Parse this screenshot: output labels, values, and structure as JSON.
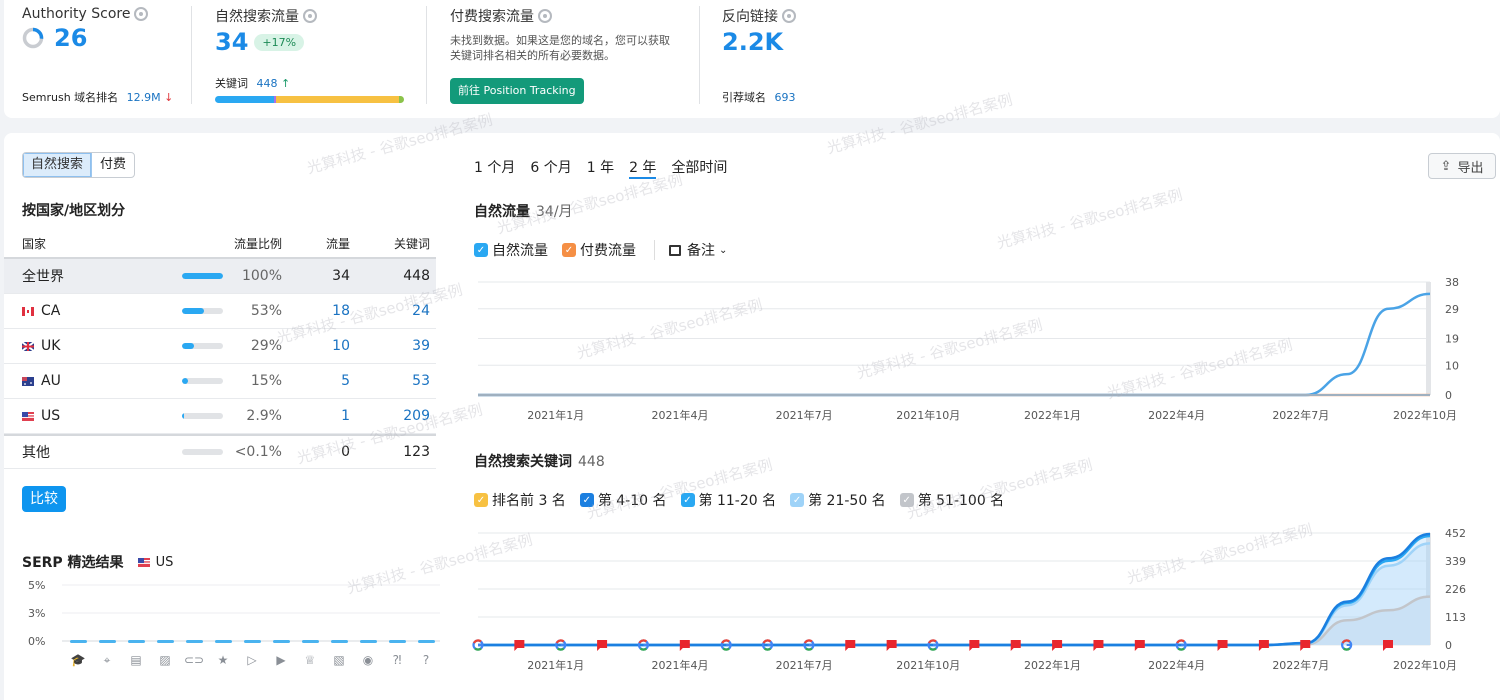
{
  "metrics": {
    "authority": {
      "title": "Authority Score",
      "value": "26",
      "rank_label": "Semrush 域名排名",
      "rank_value": "12.9M",
      "rank_trend": "down"
    },
    "organic": {
      "title": "自然搜索流量",
      "value": "34",
      "change": "+17%",
      "kw_label": "关键词",
      "kw_value": "448",
      "kw_trend": "up",
      "bar_segments": [
        {
          "color": "#2aa8f2",
          "pct": 31
        },
        {
          "color": "#a970e8",
          "pct": 1.5
        },
        {
          "color": "#f7c142",
          "pct": 65
        },
        {
          "color": "#8bc34a",
          "pct": 2.5
        }
      ]
    },
    "paid": {
      "title": "付费搜索流量",
      "message": "未找到数据。如果这是您的域名，您可以获取关键词排名相关的所有必要数据。",
      "button": "前往 Position Tracking"
    },
    "backlinks": {
      "title": "反向链接",
      "value": "2.2K",
      "ref_label": "引荐域名",
      "ref_value": "693"
    }
  },
  "left": {
    "segment": [
      "自然搜索",
      "付费"
    ],
    "segment_active": 0,
    "country_title": "按国家/地区划分",
    "headers": [
      "国家",
      "流量比例",
      "流量",
      "关键词"
    ],
    "rows": [
      {
        "name": "全世界",
        "flag": "",
        "share": 100,
        "pct": "100%",
        "traffic": "34",
        "keywords": "448",
        "selected": true
      },
      {
        "name": "CA",
        "flag": "ca",
        "share": 53,
        "pct": "53%",
        "traffic": "18",
        "keywords": "24"
      },
      {
        "name": "UK",
        "flag": "uk",
        "share": 29,
        "pct": "29%",
        "traffic": "10",
        "keywords": "39"
      },
      {
        "name": "AU",
        "flag": "au",
        "share": 15,
        "pct": "15%",
        "traffic": "5",
        "keywords": "53"
      },
      {
        "name": "US",
        "flag": "us",
        "share": 2.9,
        "pct": "2.9%",
        "traffic": "1",
        "keywords": "209"
      },
      {
        "name": "其他",
        "flag": "",
        "share": 0,
        "pct": "<0.1%",
        "traffic": "0",
        "keywords": "123"
      }
    ],
    "compare_button": "比较",
    "serp_title": "SERP 精选结果",
    "serp_country": "US",
    "serp_ticks": [
      "5%",
      "3%",
      "0%"
    ],
    "serp_icons": [
      "graduation-cap-icon",
      "map-pin-icon",
      "news-icon",
      "image-icon",
      "link-icon",
      "star-icon",
      "video-play-icon",
      "video-box-icon",
      "crown-icon",
      "image-pack-icon",
      "play-circle-icon",
      "faq-icon",
      "question-icon"
    ]
  },
  "right": {
    "time_tabs": [
      "1 个月",
      "6 个月",
      "1 年",
      "2 年",
      "全部时间"
    ],
    "time_active": 3,
    "export_label": "导出",
    "traffic_title": "自然流量",
    "traffic_sub": "34/月",
    "traffic_legend": [
      {
        "label": "自然流量",
        "color": "#2aa8f2"
      },
      {
        "label": "付费流量",
        "color": "#f58f45"
      }
    ],
    "notes_label": "备注",
    "kw_title": "自然搜索关键词",
    "kw_sub": "448",
    "kw_legend": [
      {
        "label": "排名前 3 名",
        "color": "#f7c142"
      },
      {
        "label": "第 4-10 名",
        "color": "#1b7fe0"
      },
      {
        "label": "第 11-20 名",
        "color": "#2aa8f2"
      },
      {
        "label": "第 21-50 名",
        "color": "#9fd3f8"
      },
      {
        "label": "第 51-100 名",
        "color": "#c2c5ca"
      }
    ]
  },
  "chart_data": [
    {
      "type": "line",
      "title": "自然流量",
      "x_ticks": [
        "2021年1月",
        "2021年4月",
        "2021年7月",
        "2021年10月",
        "2022年1月",
        "2022年4月",
        "2022年7月",
        "2022年10月"
      ],
      "y_ticks": [
        "0",
        "10",
        "19",
        "29",
        "38"
      ],
      "ylim": [
        0,
        38
      ],
      "x": [
        "2020-11",
        "2020-12",
        "2021-01",
        "2021-02",
        "2021-03",
        "2021-04",
        "2021-05",
        "2021-06",
        "2021-07",
        "2021-08",
        "2021-09",
        "2021-10",
        "2021-11",
        "2021-12",
        "2022-01",
        "2022-02",
        "2022-03",
        "2022-04",
        "2022-05",
        "2022-06",
        "2022-07",
        "2022-08",
        "2022-09",
        "2022-10"
      ],
      "series": [
        {
          "name": "自然流量",
          "color": "#4aa3e6",
          "values": [
            0,
            0,
            0,
            0,
            0,
            0,
            0,
            0,
            0,
            0,
            0,
            0,
            0,
            0,
            0,
            0,
            0,
            0,
            0,
            0,
            0,
            7,
            29,
            34
          ]
        },
        {
          "name": "付费流量",
          "color": "#f5b08a",
          "values": [
            0,
            0,
            0,
            0,
            0,
            0,
            0,
            0,
            0,
            0,
            0,
            0,
            0,
            0,
            0,
            0,
            0,
            0,
            0,
            0,
            0,
            0,
            0,
            0
          ]
        }
      ]
    },
    {
      "type": "area",
      "title": "自然搜索关键词",
      "x_ticks": [
        "2021年1月",
        "2021年4月",
        "2021年7月",
        "2021年10月",
        "2022年1月",
        "2022年4月",
        "2022年7月",
        "2022年10月"
      ],
      "y_ticks": [
        "0",
        "113",
        "226",
        "339",
        "452"
      ],
      "ylim": [
        0,
        452
      ],
      "x": [
        "2020-11",
        "2020-12",
        "2021-01",
        "2021-02",
        "2021-03",
        "2021-04",
        "2021-05",
        "2021-06",
        "2021-07",
        "2021-08",
        "2021-09",
        "2021-10",
        "2021-11",
        "2021-12",
        "2022-01",
        "2022-02",
        "2022-03",
        "2022-04",
        "2022-05",
        "2022-06",
        "2022-07",
        "2022-08",
        "2022-09",
        "2022-10"
      ],
      "series": [
        {
          "name": "第 51-100 名 (cumulative)",
          "color": "#c2c5ca",
          "values": [
            0,
            0,
            0,
            0,
            0,
            0,
            0,
            0,
            0,
            0,
            0,
            0,
            0,
            0,
            0,
            0,
            0,
            0,
            0,
            0,
            2,
            100,
            140,
            195
          ]
        },
        {
          "name": "第 21-50 名 (cumulative)",
          "color": "#9fd3f8",
          "values": [
            0,
            0,
            0,
            0,
            0,
            0,
            0,
            0,
            0,
            0,
            0,
            0,
            0,
            0,
            0,
            0,
            0,
            0,
            0,
            0,
            5,
            160,
            320,
            410
          ]
        },
        {
          "name": "第 11-20 名 (cumulative)",
          "color": "#2aa8f2",
          "values": [
            0,
            0,
            0,
            0,
            0,
            0,
            0,
            0,
            0,
            0,
            0,
            0,
            0,
            0,
            0,
            0,
            0,
            0,
            0,
            0,
            7,
            170,
            340,
            440
          ]
        },
        {
          "name": "第 4-10 名 (cumulative)",
          "color": "#1b7fe0",
          "values": [
            0,
            0,
            0,
            0,
            0,
            0,
            0,
            0,
            0,
            0,
            0,
            0,
            0,
            0,
            0,
            0,
            0,
            0,
            0,
            0,
            8,
            175,
            350,
            448
          ]
        }
      ],
      "markers": [
        "google",
        "flag",
        "google",
        "flag",
        "google",
        "flag",
        "google",
        "google",
        "google",
        "flag",
        "flag",
        "google",
        "flag",
        "flag",
        "flag",
        "flag",
        "flag",
        "google",
        "flag",
        "flag",
        "flag",
        "google",
        "flag"
      ]
    },
    {
      "type": "bar",
      "title": "SERP 精选结果",
      "y_ticks": [
        "0%",
        "3%",
        "5%"
      ],
      "ylim": [
        0,
        5
      ],
      "categories": [
        "graduation-cap",
        "map-pin",
        "news",
        "image",
        "link",
        "star",
        "video",
        "video-box",
        "crown",
        "image-pack",
        "play",
        "faq",
        "question"
      ],
      "values": [
        0,
        0,
        0,
        0,
        0,
        0,
        0,
        0,
        0,
        0,
        0,
        0,
        0
      ]
    }
  ]
}
